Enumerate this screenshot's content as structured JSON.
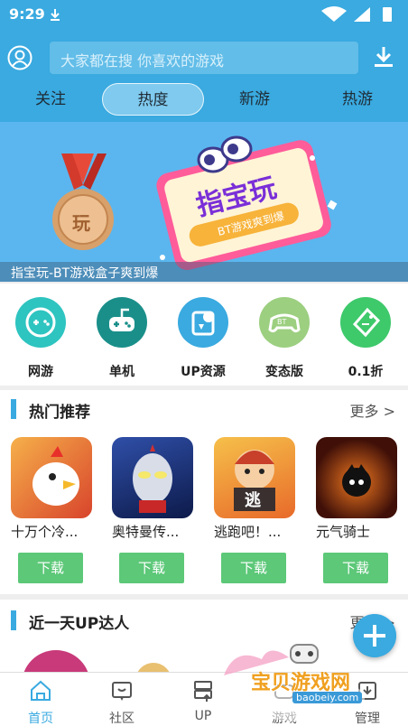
{
  "status": {
    "time": "9:29"
  },
  "search": {
    "placeholder": "大家都在搜  你喜欢的游戏"
  },
  "tabs": [
    {
      "label": "关注"
    },
    {
      "label": "热度",
      "active": true
    },
    {
      "label": "新游"
    },
    {
      "label": "热游"
    }
  ],
  "banner": {
    "caption": "指宝玩-BT游戏盒子爽到爆",
    "medal_text": "玩",
    "sign_title": "指宝玩",
    "sign_subtitle": "BT游戏爽到爆"
  },
  "categories": [
    {
      "label": "网游",
      "color": "#2ec4c0",
      "icon": "gamepad-icon"
    },
    {
      "label": "单机",
      "color": "#1a8f8a",
      "icon": "controller-icon"
    },
    {
      "label": "UP资源",
      "color": "#3aaae0",
      "icon": "share-icon"
    },
    {
      "label": "变态版",
      "color": "#9ccf80",
      "icon": "bt-controller-icon"
    },
    {
      "label": "0.1折",
      "color": "#3ec96b",
      "icon": "discount-tag-icon"
    }
  ],
  "hot": {
    "title": "热门推荐",
    "more": "更多 >",
    "download_label": "下载",
    "games": [
      {
        "name": "十万个冷...",
        "color1": "#e8583a",
        "color2": "#f3c06b"
      },
      {
        "name": "奥特曼传...",
        "color1": "#233a8c",
        "color2": "#d23a3a"
      },
      {
        "name": "逃跑吧！...",
        "color1": "#f0a43a",
        "color2": "#e8623a"
      },
      {
        "name": "元气骑士",
        "color1": "#1a1a1a",
        "color2": "#e86a1a"
      }
    ]
  },
  "up": {
    "title": "近一天UP达人",
    "more": "更多 >"
  },
  "nav": [
    {
      "label": "首页",
      "icon": "home-icon",
      "active": true
    },
    {
      "label": "社区",
      "icon": "community-icon"
    },
    {
      "label": "UP",
      "icon": "up-icon"
    },
    {
      "label": "游戏",
      "icon": "game-icon"
    },
    {
      "label": "管理",
      "icon": "manage-icon"
    }
  ],
  "watermark": {
    "title": "宝贝游戏网",
    "url": "baobeiy.com"
  }
}
